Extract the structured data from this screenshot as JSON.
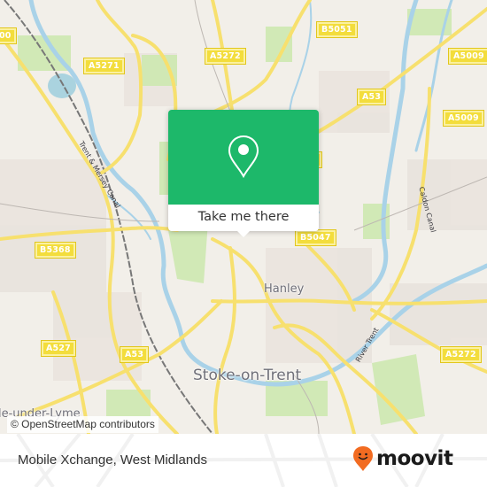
{
  "map": {
    "colors": {
      "background": "#f2efe9",
      "water": "#aad3df",
      "park": "#c8e6a8",
      "road": "#f7e06e",
      "accent": "#1db86a",
      "moovit_orange": "#f26b21"
    },
    "road_labels": [
      {
        "id": "a5271",
        "text": "A5271"
      },
      {
        "id": "a5272-top",
        "text": "A5272"
      },
      {
        "id": "b5051",
        "text": "B5051"
      },
      {
        "id": "a5009-top",
        "text": "A5009"
      },
      {
        "id": "a53-top",
        "text": "A53"
      },
      {
        "id": "a5009-mid",
        "text": "A5009"
      },
      {
        "id": "b5368",
        "text": "B5368"
      },
      {
        "id": "b5047",
        "text": "B5047"
      },
      {
        "id": "a527",
        "text": "A527"
      },
      {
        "id": "a53-bottom",
        "text": "A53"
      },
      {
        "id": "a5272-bottom",
        "text": "A5272"
      },
      {
        "id": "a500-edge",
        "text": "00"
      }
    ],
    "place_labels": {
      "hanley": "Hanley",
      "stoke": "Stoke-on-Trent",
      "newcastle": "le-under-Lyme"
    },
    "water_labels": {
      "trent_mersey": "Trent & Mersey Canal",
      "caldon": "Caldon Canal",
      "river_trent": "River Trent"
    },
    "attribution": "© OpenStreetMap contributors"
  },
  "popup": {
    "icon": "location-pin-icon",
    "cta_label": "Take me there"
  },
  "footer": {
    "title": "Mobile Xchange, West Midlands",
    "brand": "moovit",
    "brand_icon": "moovit-smiley-pin-icon"
  }
}
